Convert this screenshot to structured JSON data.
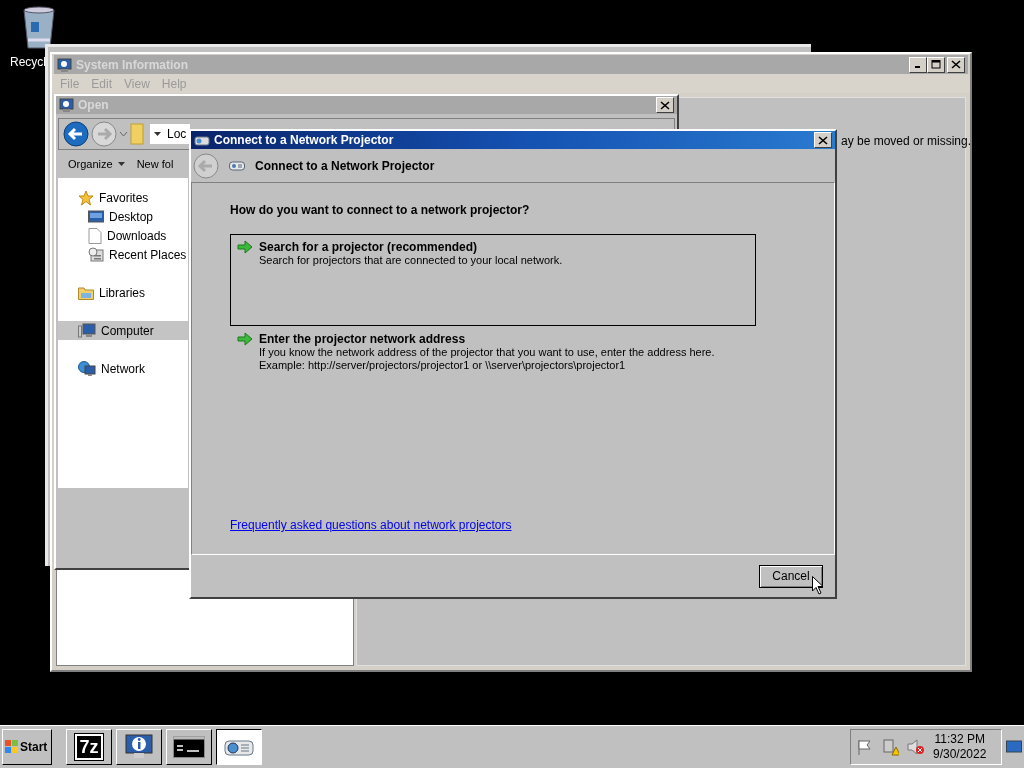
{
  "desktop_icons": [
    {
      "label": "Recycl"
    }
  ],
  "system_information": {
    "title": "System Information",
    "menu": [
      "File",
      "Edit",
      "View",
      "Help"
    ],
    "message": "ay be moved or missing."
  },
  "open_dialog": {
    "title": "Open",
    "breadcrumb": "Loc",
    "toolbar": [
      "Organize",
      "New fol"
    ],
    "nav": [
      {
        "label": "Favorites",
        "kind": "star",
        "selected": false,
        "children": [
          {
            "label": "Desktop",
            "kind": "desktop",
            "selected": false
          },
          {
            "label": "Downloads",
            "kind": "page",
            "selected": false
          },
          {
            "label": "Recent Places",
            "kind": "recent",
            "selected": false
          }
        ]
      },
      {
        "label": "Libraries",
        "kind": "folder",
        "selected": false
      },
      {
        "label": "Computer",
        "kind": "computer",
        "selected": true
      },
      {
        "label": "Network",
        "kind": "network",
        "selected": false
      }
    ]
  },
  "projector_dialog": {
    "title": "Connect to a Network Projector",
    "header": "Connect to a Network Projector",
    "question": "How do you want to connect to a network projector?",
    "options": [
      {
        "title": "Search for a projector (recommended)",
        "description": [
          "Search for projectors that are connected to your local network."
        ],
        "selected": true
      },
      {
        "title": "Enter the projector network address",
        "description": [
          "If you know the network address of the projector that you want to use, enter the address here.",
          "Example: http://server/projectors/projector1 or \\\\server\\projectors\\projector1"
        ],
        "selected": false
      }
    ],
    "link": "Frequently asked questions about network projectors",
    "buttons": [
      "Cancel"
    ]
  },
  "taskbar": {
    "start": "Start",
    "items": [
      {
        "kind": "sevenzip",
        "label": "7z",
        "selected": false
      },
      {
        "kind": "info",
        "selected": false
      },
      {
        "kind": "console",
        "selected": false
      },
      {
        "kind": "projector",
        "selected": true
      }
    ],
    "tray": {
      "time": "11:32 PM",
      "date": "9/30/2022"
    }
  }
}
